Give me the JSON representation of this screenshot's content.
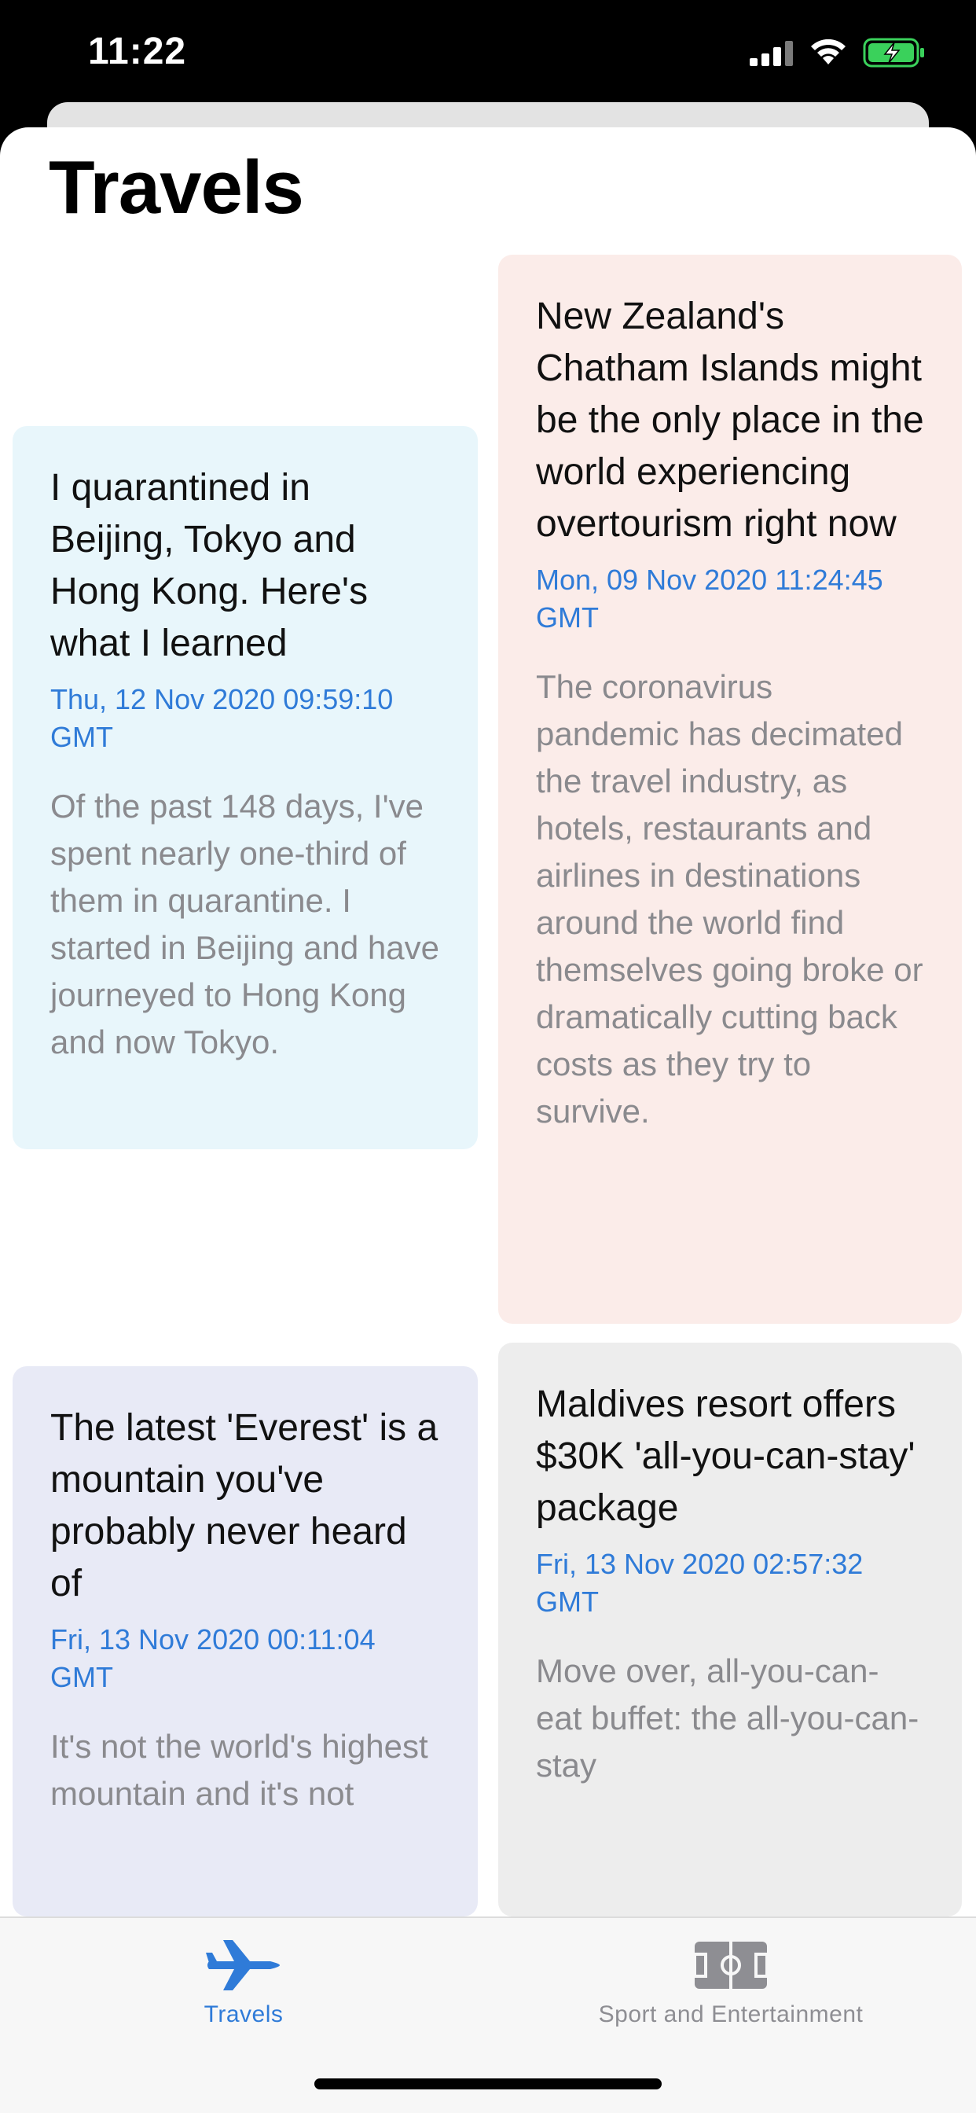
{
  "status_bar": {
    "time": "11:22"
  },
  "page": {
    "title": "Travels"
  },
  "cards": [
    {
      "title": "I quarantined in Beijing, Tokyo and Hong Kong. Here's what I learned",
      "date": "Thu, 12 Nov 2020 09:59:10 GMT",
      "description": "Of the past 148 days, I've spent nearly one-third of them in quarantine. I started in Beijing and have journeyed to Hong Kong and now Tokyo.",
      "background": "#e8f6fb"
    },
    {
      "title": "New Zealand's Chatham Islands might be the only place in the world experiencing overtourism right now",
      "date": "Mon, 09 Nov 2020 11:24:45 GMT",
      "description": "The coronavirus pandemic has decimated the travel industry, as hotels, restaurants and airlines in destinations around the world find themselves going broke or dramatically cutting back costs as they try to survive.",
      "background": "#fbece9"
    },
    {
      "title": "The latest 'Everest' is a mountain you've probably never heard of",
      "date": "Fri, 13 Nov 2020 00:11:04 GMT",
      "description": "It's not the world's highest mountain and it's not",
      "background": "#e8eaf6"
    },
    {
      "title": "Maldives resort offers $30K 'all-you-can-stay' package",
      "date": "Fri, 13 Nov 2020 02:57:32 GMT",
      "description": "Move over, all-you-can-eat buffet: the all-you-can-stay",
      "background": "#ededed"
    }
  ],
  "tab_bar": {
    "tabs": [
      {
        "label": "Travels",
        "icon": "airplane-icon",
        "selected": true
      },
      {
        "label": "Sport and Entertainment",
        "icon": "stadium-icon",
        "selected": false
      }
    ]
  },
  "colors": {
    "accent": "#2f7bd8",
    "inactive": "#8e8e93"
  }
}
